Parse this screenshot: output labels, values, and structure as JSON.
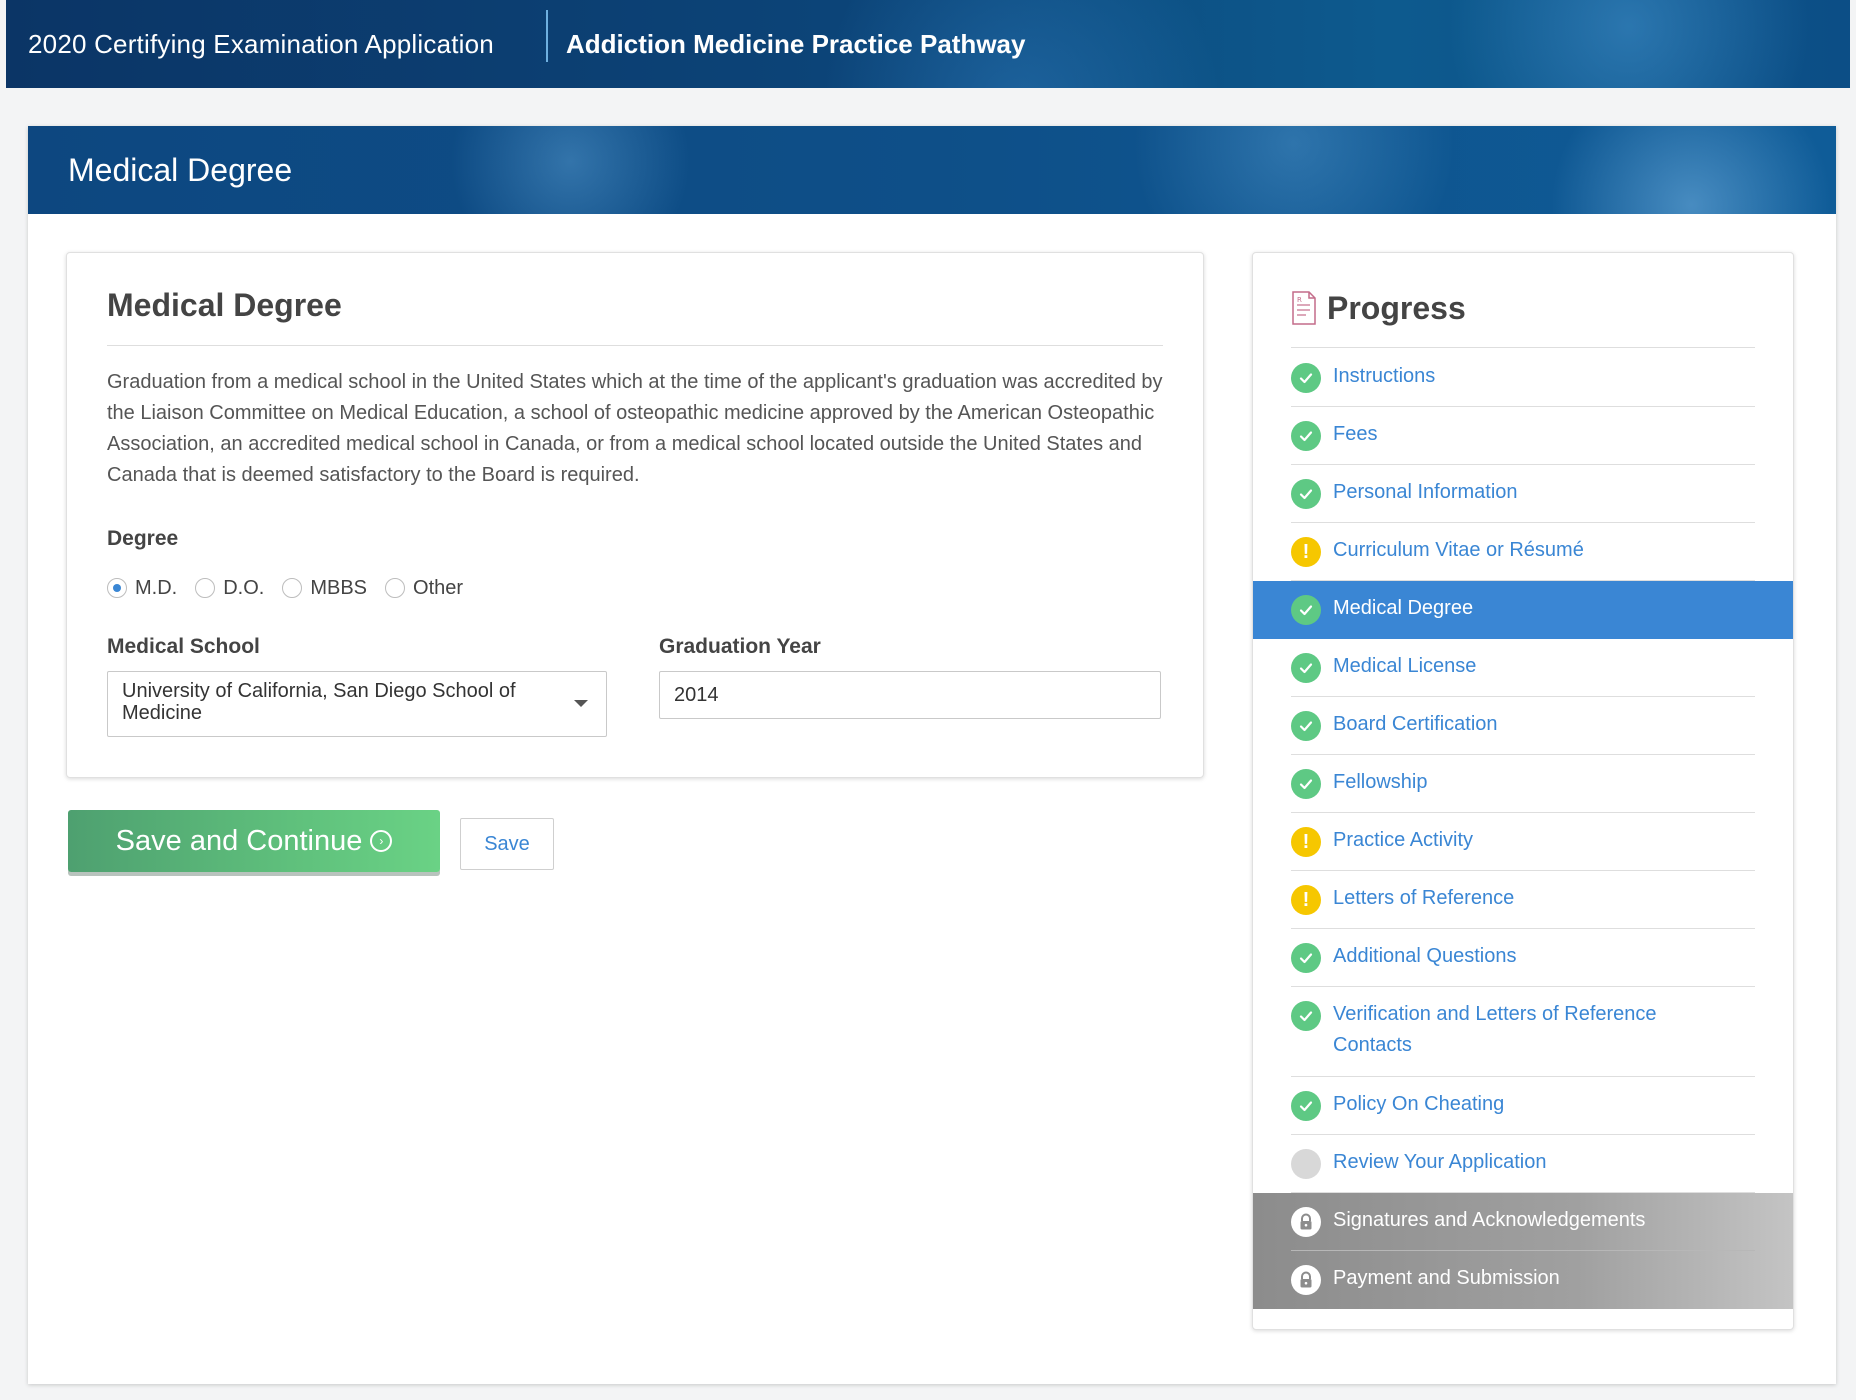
{
  "header": {
    "app_title": "2020 Certifying Examination Application",
    "pathway": "Addiction Medicine Practice Pathway"
  },
  "page": {
    "banner_title": "Medical Degree"
  },
  "form": {
    "title": "Medical Degree",
    "description": "Graduation from a medical school in the United States which at the time of the applicant's graduation was accredited by the Liaison Committee on Medical Education, a school of osteopathic medicine approved by the American Osteopathic Association, an accredited medical school in Canada, or from a medical school located outside the United States and Canada that is deemed satisfactory to the Board is required.",
    "degree_label": "Degree",
    "degree_options": [
      {
        "label": "M.D.",
        "selected": true
      },
      {
        "label": "D.O.",
        "selected": false
      },
      {
        "label": "MBBS",
        "selected": false
      },
      {
        "label": "Other",
        "selected": false
      }
    ],
    "school_label": "Medical School",
    "school_value": "University of California, San Diego School of Medicine",
    "grad_year_label": "Graduation Year",
    "grad_year_value": "2014"
  },
  "actions": {
    "save_continue_label": "Save and Continue",
    "save_label": "Save"
  },
  "progress": {
    "title": "Progress",
    "items": [
      {
        "label": "Instructions",
        "status": "done"
      },
      {
        "label": "Fees",
        "status": "done"
      },
      {
        "label": "Personal Information",
        "status": "done"
      },
      {
        "label": "Curriculum Vitae or Résumé",
        "status": "warning"
      },
      {
        "label": "Medical Degree",
        "status": "done",
        "active": true
      },
      {
        "label": "Medical License",
        "status": "done"
      },
      {
        "label": "Board Certification",
        "status": "done"
      },
      {
        "label": "Fellowship",
        "status": "done"
      },
      {
        "label": "Practice Activity",
        "status": "warning"
      },
      {
        "label": "Letters of Reference",
        "status": "warning"
      },
      {
        "label": "Additional Questions",
        "status": "done"
      },
      {
        "label": "Verification and Letters of Reference Contacts",
        "status": "done"
      },
      {
        "label": "Policy On Cheating",
        "status": "done"
      },
      {
        "label": "Review Your Application",
        "status": "pending"
      },
      {
        "label": "Signatures and Acknowledgements",
        "status": "locked"
      },
      {
        "label": "Payment and Submission",
        "status": "locked"
      }
    ]
  },
  "colors": {
    "accent": "#3a86d4",
    "done": "#5ec984",
    "warning": "#f6c700",
    "pending": "#d8d8d8",
    "primary_button": "#5fc07c"
  },
  "icons": {
    "done": "checkmark-icon",
    "warning": "exclamation-icon",
    "pending": "empty-circle-icon",
    "locked": "lock-icon",
    "progress": "document-icon",
    "save_continue": "arrow-circle-right-icon",
    "dropdown": "chevron-down-icon"
  }
}
